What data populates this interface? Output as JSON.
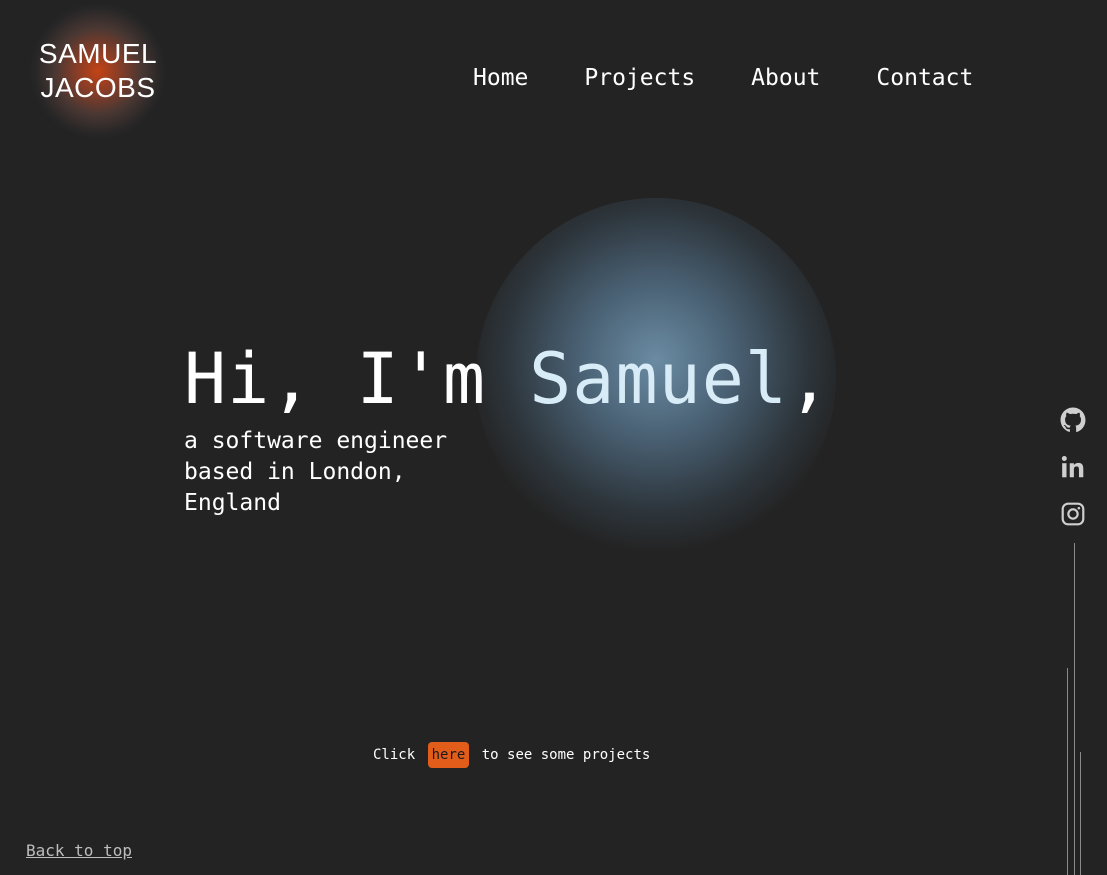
{
  "logo": {
    "line1": "SAMUEL",
    "line2": "JACOBS"
  },
  "nav": {
    "home": "Home",
    "projects": "Projects",
    "about": "About",
    "contact": "Contact"
  },
  "hero": {
    "greeting": "Hi, I'm ",
    "name": "Samuel",
    "comma": ",",
    "subtitle": "a software engineer based in London, England"
  },
  "cta": {
    "before": "Click",
    "link": "here",
    "after": "to see some projects"
  },
  "footer": {
    "back_to_top": "Back to top"
  },
  "social": [
    {
      "icon": "github-icon"
    },
    {
      "icon": "linkedin-icon"
    },
    {
      "icon": "instagram-icon"
    }
  ],
  "colors": {
    "background": "#232323",
    "accent": "#e35d1a",
    "name_highlight": "#d8ecf7",
    "muted": "#bdbdbd"
  }
}
